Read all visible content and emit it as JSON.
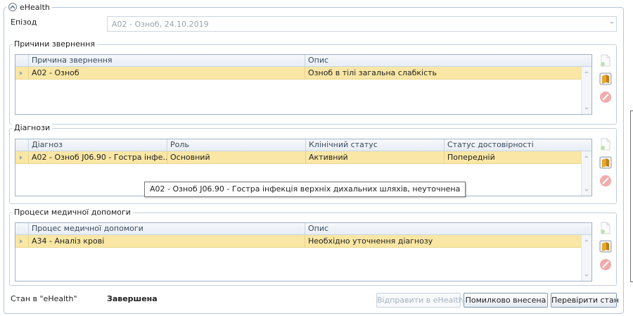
{
  "panel": {
    "title": "eHealth"
  },
  "episode": {
    "label": "Епізод",
    "value": "A02 - Озноб, 24.10.2019"
  },
  "reasons": {
    "title": "Причини звернення",
    "columns": [
      "Причина звернення",
      "Опис"
    ],
    "rows": [
      {
        "reason": "A02 - Озноб",
        "description": "Озноб в тілі загальна слабкість"
      }
    ]
  },
  "diagnoses": {
    "title": "Діагнози",
    "columns": [
      "Діагноз",
      "Роль",
      "Клінічний статус",
      "Статус достовірності"
    ],
    "rows": [
      {
        "diagnosis": "A02 - Озноб J06.90 - Гостра інфе...",
        "role": "Основний",
        "clinical_status": "Активний",
        "verification_status": "Попередній"
      }
    ],
    "tooltip": "A02 - Озноб J06.90 - Гостра інфекція верхніх дихальних шляхів, неуточнена"
  },
  "procedures": {
    "title": "Процеси медичної допомоги",
    "columns": [
      "Процес медичної допомоги",
      "Опис"
    ],
    "rows": [
      {
        "procedure": "A34 - Аналіз крові",
        "description": "Необхідно уточнення діагнозу"
      }
    ]
  },
  "status": {
    "label": "Стан в \"eHealth\"",
    "value": "Завершена"
  },
  "buttons": {
    "send": "Відправити в eHealth",
    "mark_error": "Помилково внесена",
    "check_status": "Перевірити стан"
  },
  "icons": {
    "add": "add-document-icon",
    "edit": "edit-icon",
    "delete": "delete-icon",
    "collapse": "collapse-icon"
  }
}
